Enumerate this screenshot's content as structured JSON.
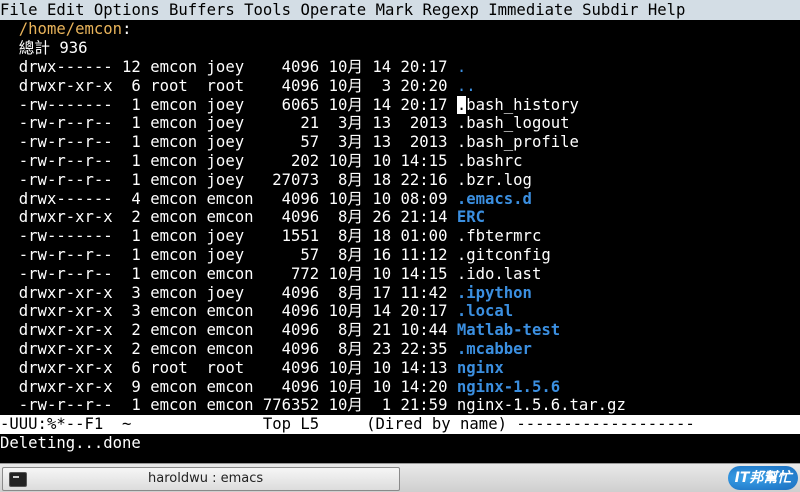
{
  "menu": [
    "File",
    "Edit",
    "Options",
    "Buffers",
    "Tools",
    "Operate",
    "Mark",
    "Regexp",
    "Immediate",
    "Subdir",
    "Help"
  ],
  "dired": {
    "path": "/home/emcon",
    "total_label": "總計 936",
    "entries": [
      {
        "perms": "drwx------",
        "links": "12",
        "owner": "emcon",
        "group": "joey",
        "size": "4096",
        "month": "10月",
        "day": "14",
        "time": "20:17",
        "name": ".",
        "kind": "dir"
      },
      {
        "perms": "drwxr-xr-x",
        "links": "6",
        "owner": "root",
        "group": "root",
        "size": "4096",
        "month": "10月",
        "day": "3",
        "time": "20:20",
        "name": "..",
        "kind": "dir"
      },
      {
        "perms": "-rw-------",
        "links": "1",
        "owner": "emcon",
        "group": "joey",
        "size": "6065",
        "month": "10月",
        "day": "14",
        "time": "20:17",
        "name": ".bash_history",
        "kind": "file",
        "cursor": true
      },
      {
        "perms": "-rw-r--r--",
        "links": "1",
        "owner": "emcon",
        "group": "joey",
        "size": "21",
        "month": "3月",
        "day": "13",
        "time": "2013",
        "name": ".bash_logout",
        "kind": "file"
      },
      {
        "perms": "-rw-r--r--",
        "links": "1",
        "owner": "emcon",
        "group": "joey",
        "size": "57",
        "month": "3月",
        "day": "13",
        "time": "2013",
        "name": ".bash_profile",
        "kind": "file"
      },
      {
        "perms": "-rw-r--r--",
        "links": "1",
        "owner": "emcon",
        "group": "joey",
        "size": "202",
        "month": "10月",
        "day": "10",
        "time": "14:15",
        "name": ".bashrc",
        "kind": "file"
      },
      {
        "perms": "-rw-r--r--",
        "links": "1",
        "owner": "emcon",
        "group": "joey",
        "size": "27073",
        "month": "8月",
        "day": "18",
        "time": "22:16",
        "name": ".bzr.log",
        "kind": "file"
      },
      {
        "perms": "drwx------",
        "links": "4",
        "owner": "emcon",
        "group": "emcon",
        "size": "4096",
        "month": "10月",
        "day": "10",
        "time": "08:09",
        "name": ".emacs.d",
        "kind": "dir"
      },
      {
        "perms": "drwxr-xr-x",
        "links": "2",
        "owner": "emcon",
        "group": "emcon",
        "size": "4096",
        "month": "8月",
        "day": "26",
        "time": "21:14",
        "name": "ERC",
        "kind": "dir"
      },
      {
        "perms": "-rw-------",
        "links": "1",
        "owner": "emcon",
        "group": "joey",
        "size": "1551",
        "month": "8月",
        "day": "18",
        "time": "01:00",
        "name": ".fbtermrc",
        "kind": "file"
      },
      {
        "perms": "-rw-r--r--",
        "links": "1",
        "owner": "emcon",
        "group": "joey",
        "size": "57",
        "month": "8月",
        "day": "16",
        "time": "11:12",
        "name": ".gitconfig",
        "kind": "file"
      },
      {
        "perms": "-rw-r--r--",
        "links": "1",
        "owner": "emcon",
        "group": "emcon",
        "size": "772",
        "month": "10月",
        "day": "10",
        "time": "14:15",
        "name": ".ido.last",
        "kind": "file"
      },
      {
        "perms": "drwxr-xr-x",
        "links": "3",
        "owner": "emcon",
        "group": "joey",
        "size": "4096",
        "month": "8月",
        "day": "17",
        "time": "11:42",
        "name": ".ipython",
        "kind": "dir"
      },
      {
        "perms": "drwxr-xr-x",
        "links": "3",
        "owner": "emcon",
        "group": "emcon",
        "size": "4096",
        "month": "10月",
        "day": "14",
        "time": "20:17",
        "name": ".local",
        "kind": "dir"
      },
      {
        "perms": "drwxr-xr-x",
        "links": "2",
        "owner": "emcon",
        "group": "emcon",
        "size": "4096",
        "month": "8月",
        "day": "21",
        "time": "10:44",
        "name": "Matlab-test",
        "kind": "dir"
      },
      {
        "perms": "drwxr-xr-x",
        "links": "2",
        "owner": "emcon",
        "group": "emcon",
        "size": "4096",
        "month": "8月",
        "day": "23",
        "time": "22:35",
        "name": ".mcabber",
        "kind": "dir"
      },
      {
        "perms": "drwxr-xr-x",
        "links": "6",
        "owner": "root",
        "group": "root",
        "size": "4096",
        "month": "10月",
        "day": "10",
        "time": "14:13",
        "name": "nginx",
        "kind": "dir"
      },
      {
        "perms": "drwxr-xr-x",
        "links": "9",
        "owner": "emcon",
        "group": "emcon",
        "size": "4096",
        "month": "10月",
        "day": "10",
        "time": "14:20",
        "name": "nginx-1.5.6",
        "kind": "dir"
      },
      {
        "perms": "-rw-r--r--",
        "links": "1",
        "owner": "emcon",
        "group": "emcon",
        "size": "776352",
        "month": "10月",
        "day": "1",
        "time": "21:59",
        "name": "nginx-1.5.6.tar.gz",
        "kind": "file"
      }
    ]
  },
  "modeline": "-UUU:%*--F1  ~              Top L5     (Dired by name) -------------------",
  "echo_area": "Deleting...done",
  "taskbar": {
    "window_title": "haroldwu : emacs",
    "watermark_text": "IT邦幫忙"
  },
  "colors": {
    "directory": "#3b8fe0",
    "path": "#e8b35a",
    "menubar_bg": "#d3dde5"
  }
}
